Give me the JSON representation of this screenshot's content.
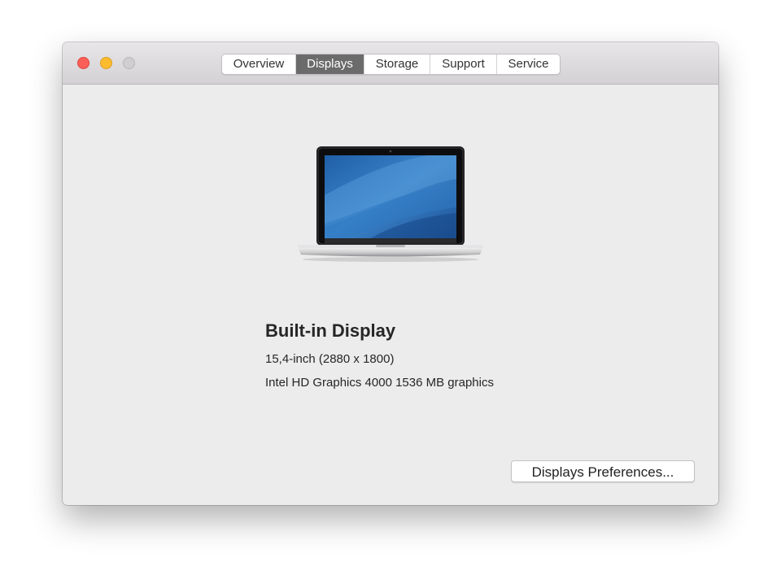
{
  "window": {
    "controls": {
      "close": "close-icon",
      "minimize": "minimize-icon",
      "zoom": "zoom-icon"
    }
  },
  "tabs": [
    {
      "label": "Overview",
      "active": false
    },
    {
      "label": "Displays",
      "active": true
    },
    {
      "label": "Storage",
      "active": false
    },
    {
      "label": "Support",
      "active": false
    },
    {
      "label": "Service",
      "active": false
    }
  ],
  "display": {
    "icon": "macbook-laptop-icon",
    "title": "Built-in Display",
    "size": "15,4-inch (2880 x 1800)",
    "graphics": "Intel HD Graphics 4000 1536 MB graphics"
  },
  "actions": {
    "preferences_label": "Displays Preferences..."
  },
  "colors": {
    "close": "#fc5f57",
    "minimize": "#fdbc2e",
    "zoom": "#d0ced0",
    "active_tab": "#6c6b6c",
    "window_bg": "#ececec"
  }
}
